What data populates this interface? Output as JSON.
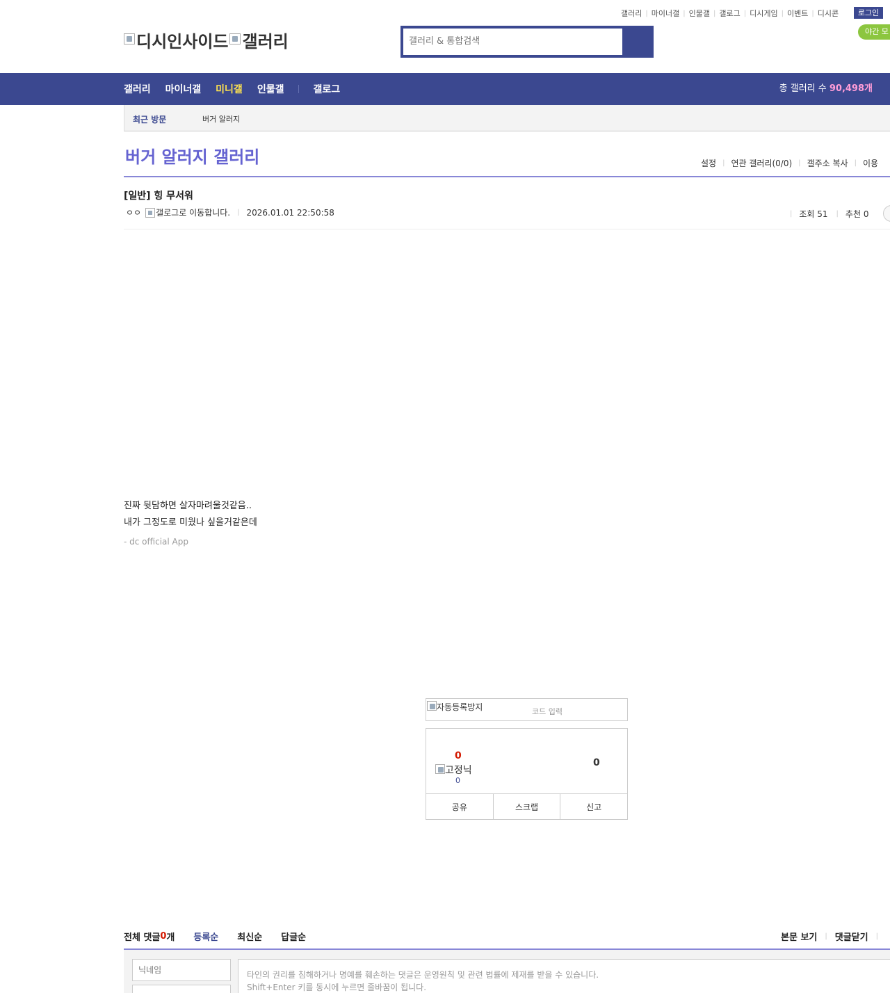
{
  "util_links": [
    "갤러리",
    "마이너갤",
    "인물갤",
    "갤로그",
    "디시게임",
    "이벤트",
    "디시콘"
  ],
  "login_label": "로그인",
  "night_mode_label": "야간 모",
  "logo": {
    "alt_left": "디시인사이드",
    "alt_right": "갤러리"
  },
  "search": {
    "placeholder": "갤러리 & 통합검색"
  },
  "nav": {
    "items": [
      "갤러리",
      "마이너갤",
      "미니갤",
      "인물갤",
      "갤로그"
    ],
    "active": "미니갤",
    "total_label": "총 갤러리 수 ",
    "total_count": "90,498개"
  },
  "recent": {
    "label": "최근 방문",
    "item": "버거 알러지"
  },
  "gallery": {
    "title": "버거 알러지 갤러리",
    "menu": [
      "설정",
      "연관 갤러리(0/0)",
      "갤주소 복사",
      "이용"
    ]
  },
  "post": {
    "title": "[일반] 힝 무서워",
    "author": "ㅇㅇ",
    "gallog_alt": "갤로그로 이동합니다.",
    "date": "2026.01.01 22:50:58",
    "views": "조회 51",
    "recommend": "추천 0",
    "body_lines": [
      "진짜 뒷담하면 살자마려울것같음..",
      "내가 그정도로 미웠나 싶을거같은데"
    ],
    "app_tag": "- dc official App"
  },
  "captcha": {
    "alt": "자동등록방지",
    "placeholder": "코드 입력"
  },
  "recommend_box": {
    "up_count": "0",
    "fix_label": "고정닉",
    "fix_count": "0",
    "down_count": "0",
    "buttons": [
      "공유",
      "스크랩",
      "신고"
    ]
  },
  "comments": {
    "total_prefix": "전체 댓글 ",
    "total_count": "0",
    "total_suffix": "개",
    "sort": [
      "등록순",
      "최신순",
      "답글순"
    ],
    "right": [
      "본문 보기",
      "댓글닫기"
    ],
    "nick_placeholder": "닉네임",
    "notice_line1": "타인의 권리를 침해하거나 명예를 훼손하는 댓글은 운영원칙 및 관련 법률에 제재를 받을 수 있습니다.",
    "notice_line2": "Shift+Enter 키를 동시에 누르면 줄바꿈이 됩니다."
  }
}
